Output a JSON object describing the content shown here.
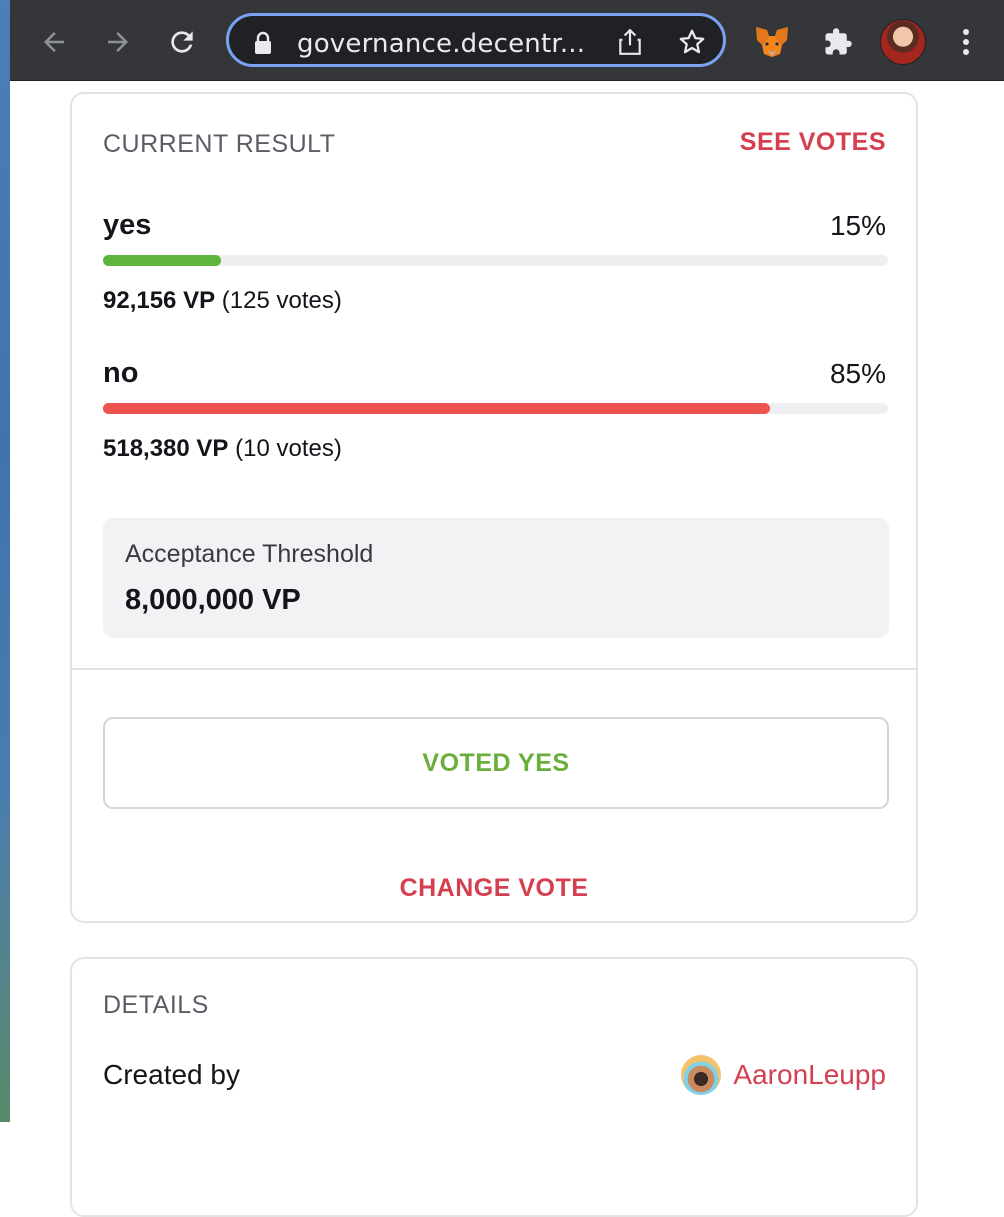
{
  "browser": {
    "url": "governance.decentr...",
    "icons": [
      "back-arrow-icon",
      "forward-arrow-icon",
      "reload-icon",
      "lock-icon",
      "share-icon",
      "star-icon",
      "metamask-fox-icon",
      "extensions-puzzle-icon",
      "profile-avatar",
      "kebab-menu-icon"
    ]
  },
  "result": {
    "title": "CURRENT RESULT",
    "see_votes": "SEE VOTES",
    "options": [
      {
        "label": "yes",
        "percent": "15%",
        "fill_fraction": 0.15,
        "vp": "92,156 VP",
        "votes": "(125 votes)",
        "color": "#5db53b"
      },
      {
        "label": "no",
        "percent": "85%",
        "fill_fraction": 0.85,
        "vp": "518,380 VP",
        "votes": "(10 votes)",
        "color": "#ef5350"
      }
    ],
    "threshold_label": "Acceptance Threshold",
    "threshold_value": "8,000,000 VP",
    "voted_label": "VOTED YES",
    "change_vote": "CHANGE VOTE"
  },
  "details": {
    "title": "DETAILS",
    "created_by_label": "Created by",
    "author": "AaronLeupp"
  },
  "colors": {
    "accent": "#d4404f",
    "yes": "#6aae3c",
    "omnibox_focus": "#7aa3f3"
  }
}
